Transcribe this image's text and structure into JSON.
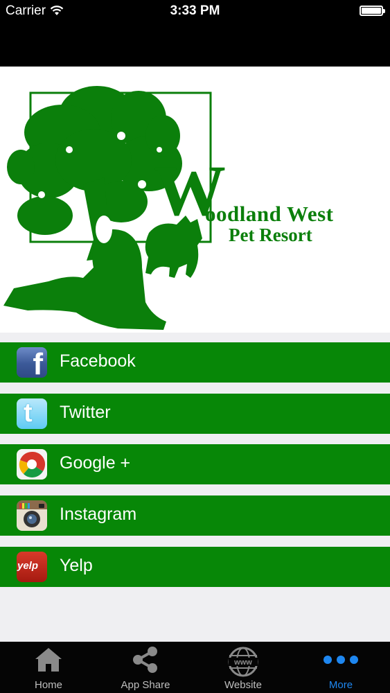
{
  "status_bar": {
    "carrier": "Carrier",
    "time": "3:33 PM",
    "icons": [
      "wifi-icon",
      "battery-icon"
    ]
  },
  "banner": {
    "brand_initial": "W",
    "brand_line1": "oodland West",
    "brand_line2": "Pet Resort",
    "brand_color": "#0b7f0b"
  },
  "social_links": [
    {
      "label": "Facebook",
      "icon": "facebook-icon"
    },
    {
      "label": "Twitter",
      "icon": "twitter-icon"
    },
    {
      "label": "Google +",
      "icon": "google-plus-icon"
    },
    {
      "label": "Instagram",
      "icon": "instagram-icon"
    },
    {
      "label": "Yelp",
      "icon": "yelp-icon"
    }
  ],
  "yelp_icon_text": "yelp",
  "row_color": "#078707",
  "tabbar": {
    "tabs": [
      {
        "label": "Home",
        "icon": "home-icon"
      },
      {
        "label": "App Share",
        "icon": "share-icon"
      },
      {
        "label": "Website",
        "icon": "www-globe-icon"
      },
      {
        "label": "More",
        "icon": "more-dots-icon",
        "active": true
      }
    ],
    "active_color": "#1e87f0"
  }
}
